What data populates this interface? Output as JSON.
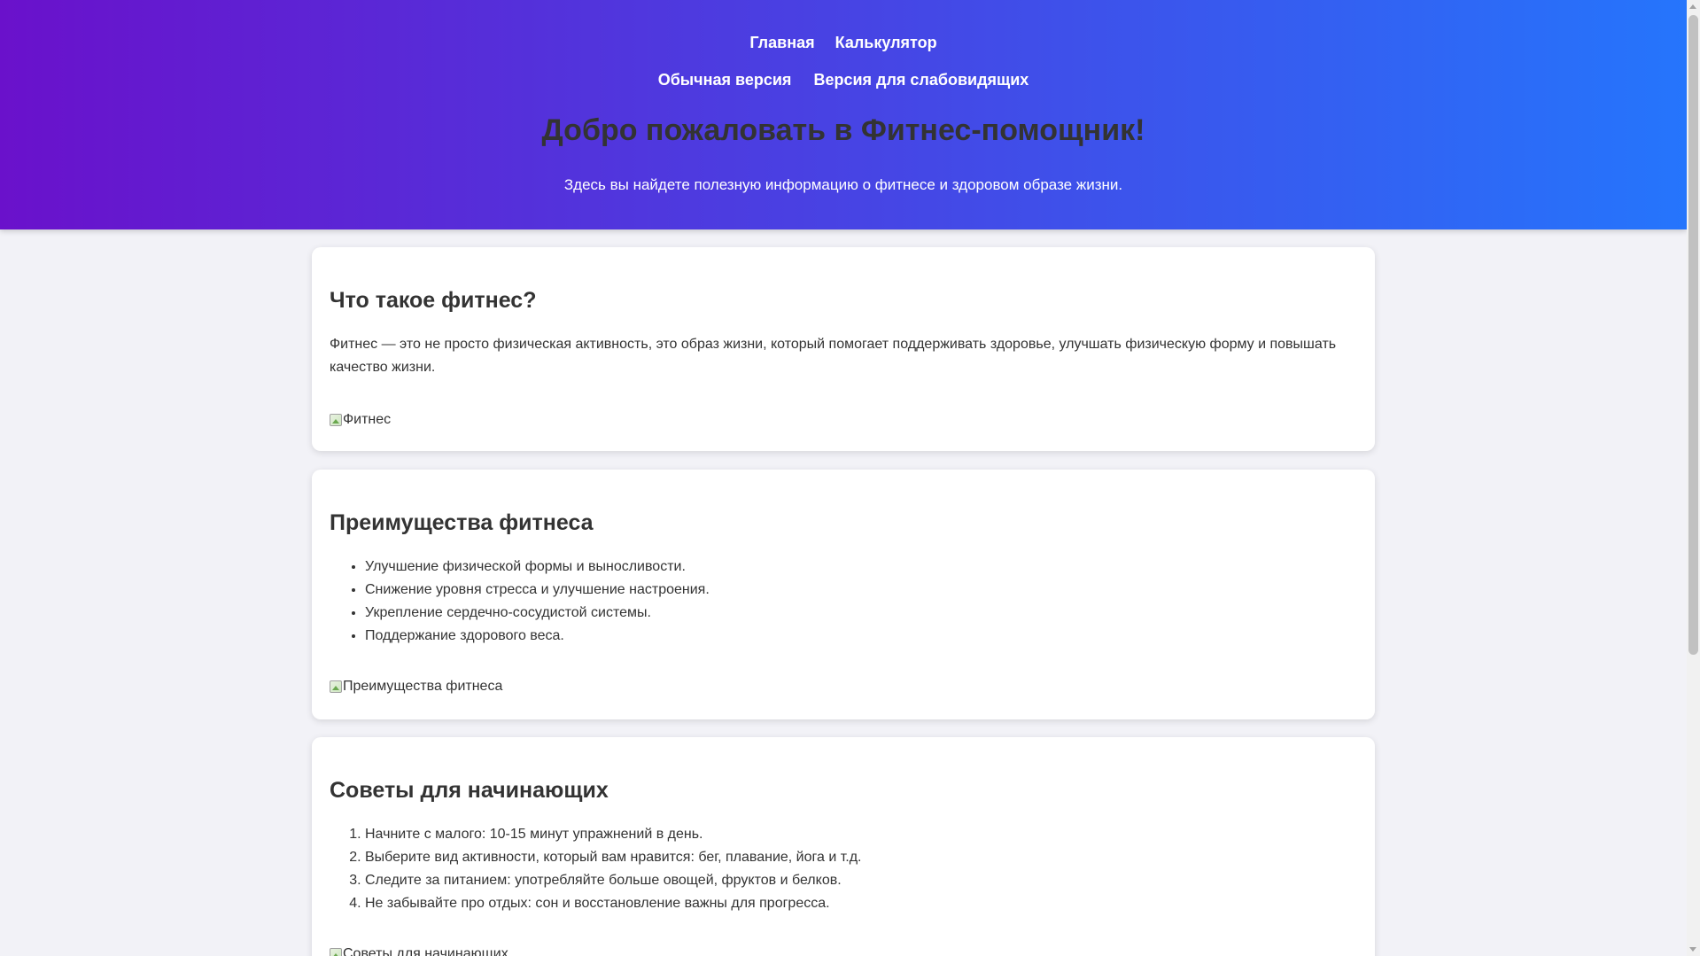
{
  "nav": {
    "home": "Главная",
    "calculator": "Калькулятор",
    "normal_version": "Обычная версия",
    "accessible_version": "Версия для слабовидящих"
  },
  "hero": {
    "title": "Добро пожаловать в Фитнес-помощник!",
    "subtitle": "Здесь вы найдете полезную информацию о фитнесе и здоровом образе жизни."
  },
  "sections": [
    {
      "title": "Что такое фитнес?",
      "text": "Фитнес — это не просто физическая активность, это образ жизни, который помогает поддерживать здоровье, улучшать физическую форму и повышать качество жизни.",
      "image_alt": "Фитнес"
    },
    {
      "title": "Преимущества фитнеса",
      "items": [
        "Улучшение физической формы и выносливости.",
        "Снижение уровня стресса и улучшение настроения.",
        "Укрепление сердечно-сосудистой системы.",
        "Поддержание здорового веса."
      ],
      "image_alt": "Преимущества фитнеса"
    },
    {
      "title": "Советы для начинающих",
      "items": [
        "Начните с малого: 10-15 минут упражнений в день.",
        "Выберите вид активности, который вам нравится: бег, плавание, йога и т.д.",
        "Следите за питанием: употребляйте больше овощей, фруктов и белков.",
        "Не забывайте про отдых: сон и восстановление важны для прогресса."
      ],
      "image_alt": "Советы для начинающих"
    }
  ],
  "colors": {
    "gradient_start": "#6a11cb",
    "gradient_end": "#2575fc",
    "page_background": "#f2f2f7",
    "card_background": "#ffffff",
    "text": "#333333"
  }
}
